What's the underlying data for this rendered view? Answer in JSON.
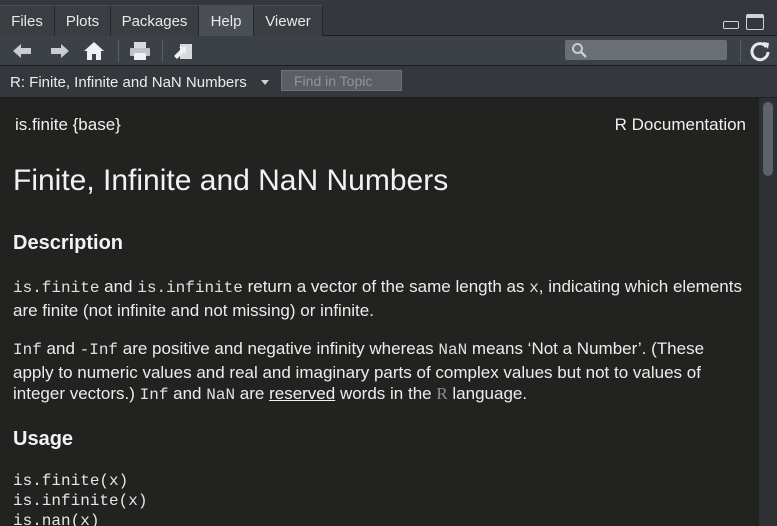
{
  "tabs": [
    {
      "label": "Files"
    },
    {
      "label": "Plots"
    },
    {
      "label": "Packages"
    },
    {
      "label": "Help"
    },
    {
      "label": "Viewer"
    }
  ],
  "active_tab": "Help",
  "toolbar": {
    "icons": [
      "back-arrow-icon",
      "forward-arrow-icon",
      "home-icon",
      "print-icon",
      "open-in-window-icon",
      "search-icon",
      "refresh-icon"
    ]
  },
  "topic": {
    "selected": "R: Finite, Infinite and NaN Numbers",
    "find_placeholder": "Find in Topic"
  },
  "doc": {
    "header_left": "is.finite {base}",
    "header_right": "R Documentation",
    "title": "Finite, Infinite and NaN Numbers",
    "section_description": "Description",
    "desc_p1": {
      "c1": "is.finite",
      "t1": " and ",
      "c2": "is.infinite",
      "t2": " return a vector of the same length as ",
      "c3": "x",
      "t3": ", indicating which elements are finite (not infinite and not missing) or infinite."
    },
    "desc_p2": {
      "c1": "Inf",
      "t1": " and ",
      "c2": "-Inf",
      "t2": " are positive and negative infinity whereas ",
      "c3": "NaN",
      "t3": " means ‘Not a Number’. (These apply to numeric values and real and imaginary parts of complex values but not to values of integer vectors.) ",
      "c4": "Inf",
      "t4": " and ",
      "c5": "NaN",
      "t5": " are ",
      "link": "reserved",
      "t6": " words in the ",
      "r": "R",
      "t7": " language."
    },
    "section_usage": "Usage",
    "usage_lines": [
      "is.finite(x)",
      "is.infinite(x)",
      "is.nan(x)"
    ]
  },
  "colors": {
    "background": "#222220",
    "tabbar": "#34383d",
    "active_tab": "#4a4f55",
    "toolbar": "#3c4147",
    "text": "#ececec"
  }
}
